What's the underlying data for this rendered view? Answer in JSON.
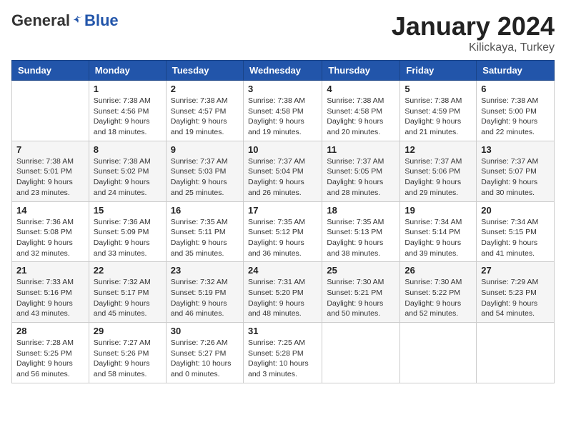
{
  "header": {
    "logo_general": "General",
    "logo_blue": "Blue",
    "title": "January 2024",
    "subtitle": "Kilickaya, Turkey"
  },
  "columns": [
    "Sunday",
    "Monday",
    "Tuesday",
    "Wednesday",
    "Thursday",
    "Friday",
    "Saturday"
  ],
  "weeks": [
    [
      {
        "day": "",
        "info": ""
      },
      {
        "day": "1",
        "info": "Sunrise: 7:38 AM\nSunset: 4:56 PM\nDaylight: 9 hours\nand 18 minutes."
      },
      {
        "day": "2",
        "info": "Sunrise: 7:38 AM\nSunset: 4:57 PM\nDaylight: 9 hours\nand 19 minutes."
      },
      {
        "day": "3",
        "info": "Sunrise: 7:38 AM\nSunset: 4:58 PM\nDaylight: 9 hours\nand 19 minutes."
      },
      {
        "day": "4",
        "info": "Sunrise: 7:38 AM\nSunset: 4:58 PM\nDaylight: 9 hours\nand 20 minutes."
      },
      {
        "day": "5",
        "info": "Sunrise: 7:38 AM\nSunset: 4:59 PM\nDaylight: 9 hours\nand 21 minutes."
      },
      {
        "day": "6",
        "info": "Sunrise: 7:38 AM\nSunset: 5:00 PM\nDaylight: 9 hours\nand 22 minutes."
      }
    ],
    [
      {
        "day": "7",
        "info": "Sunrise: 7:38 AM\nSunset: 5:01 PM\nDaylight: 9 hours\nand 23 minutes."
      },
      {
        "day": "8",
        "info": "Sunrise: 7:38 AM\nSunset: 5:02 PM\nDaylight: 9 hours\nand 24 minutes."
      },
      {
        "day": "9",
        "info": "Sunrise: 7:37 AM\nSunset: 5:03 PM\nDaylight: 9 hours\nand 25 minutes."
      },
      {
        "day": "10",
        "info": "Sunrise: 7:37 AM\nSunset: 5:04 PM\nDaylight: 9 hours\nand 26 minutes."
      },
      {
        "day": "11",
        "info": "Sunrise: 7:37 AM\nSunset: 5:05 PM\nDaylight: 9 hours\nand 28 minutes."
      },
      {
        "day": "12",
        "info": "Sunrise: 7:37 AM\nSunset: 5:06 PM\nDaylight: 9 hours\nand 29 minutes."
      },
      {
        "day": "13",
        "info": "Sunrise: 7:37 AM\nSunset: 5:07 PM\nDaylight: 9 hours\nand 30 minutes."
      }
    ],
    [
      {
        "day": "14",
        "info": "Sunrise: 7:36 AM\nSunset: 5:08 PM\nDaylight: 9 hours\nand 32 minutes."
      },
      {
        "day": "15",
        "info": "Sunrise: 7:36 AM\nSunset: 5:09 PM\nDaylight: 9 hours\nand 33 minutes."
      },
      {
        "day": "16",
        "info": "Sunrise: 7:35 AM\nSunset: 5:11 PM\nDaylight: 9 hours\nand 35 minutes."
      },
      {
        "day": "17",
        "info": "Sunrise: 7:35 AM\nSunset: 5:12 PM\nDaylight: 9 hours\nand 36 minutes."
      },
      {
        "day": "18",
        "info": "Sunrise: 7:35 AM\nSunset: 5:13 PM\nDaylight: 9 hours\nand 38 minutes."
      },
      {
        "day": "19",
        "info": "Sunrise: 7:34 AM\nSunset: 5:14 PM\nDaylight: 9 hours\nand 39 minutes."
      },
      {
        "day": "20",
        "info": "Sunrise: 7:34 AM\nSunset: 5:15 PM\nDaylight: 9 hours\nand 41 minutes."
      }
    ],
    [
      {
        "day": "21",
        "info": "Sunrise: 7:33 AM\nSunset: 5:16 PM\nDaylight: 9 hours\nand 43 minutes."
      },
      {
        "day": "22",
        "info": "Sunrise: 7:32 AM\nSunset: 5:17 PM\nDaylight: 9 hours\nand 45 minutes."
      },
      {
        "day": "23",
        "info": "Sunrise: 7:32 AM\nSunset: 5:19 PM\nDaylight: 9 hours\nand 46 minutes."
      },
      {
        "day": "24",
        "info": "Sunrise: 7:31 AM\nSunset: 5:20 PM\nDaylight: 9 hours\nand 48 minutes."
      },
      {
        "day": "25",
        "info": "Sunrise: 7:30 AM\nSunset: 5:21 PM\nDaylight: 9 hours\nand 50 minutes."
      },
      {
        "day": "26",
        "info": "Sunrise: 7:30 AM\nSunset: 5:22 PM\nDaylight: 9 hours\nand 52 minutes."
      },
      {
        "day": "27",
        "info": "Sunrise: 7:29 AM\nSunset: 5:23 PM\nDaylight: 9 hours\nand 54 minutes."
      }
    ],
    [
      {
        "day": "28",
        "info": "Sunrise: 7:28 AM\nSunset: 5:25 PM\nDaylight: 9 hours\nand 56 minutes."
      },
      {
        "day": "29",
        "info": "Sunrise: 7:27 AM\nSunset: 5:26 PM\nDaylight: 9 hours\nand 58 minutes."
      },
      {
        "day": "30",
        "info": "Sunrise: 7:26 AM\nSunset: 5:27 PM\nDaylight: 10 hours\nand 0 minutes."
      },
      {
        "day": "31",
        "info": "Sunrise: 7:25 AM\nSunset: 5:28 PM\nDaylight: 10 hours\nand 3 minutes."
      },
      {
        "day": "",
        "info": ""
      },
      {
        "day": "",
        "info": ""
      },
      {
        "day": "",
        "info": ""
      }
    ]
  ]
}
